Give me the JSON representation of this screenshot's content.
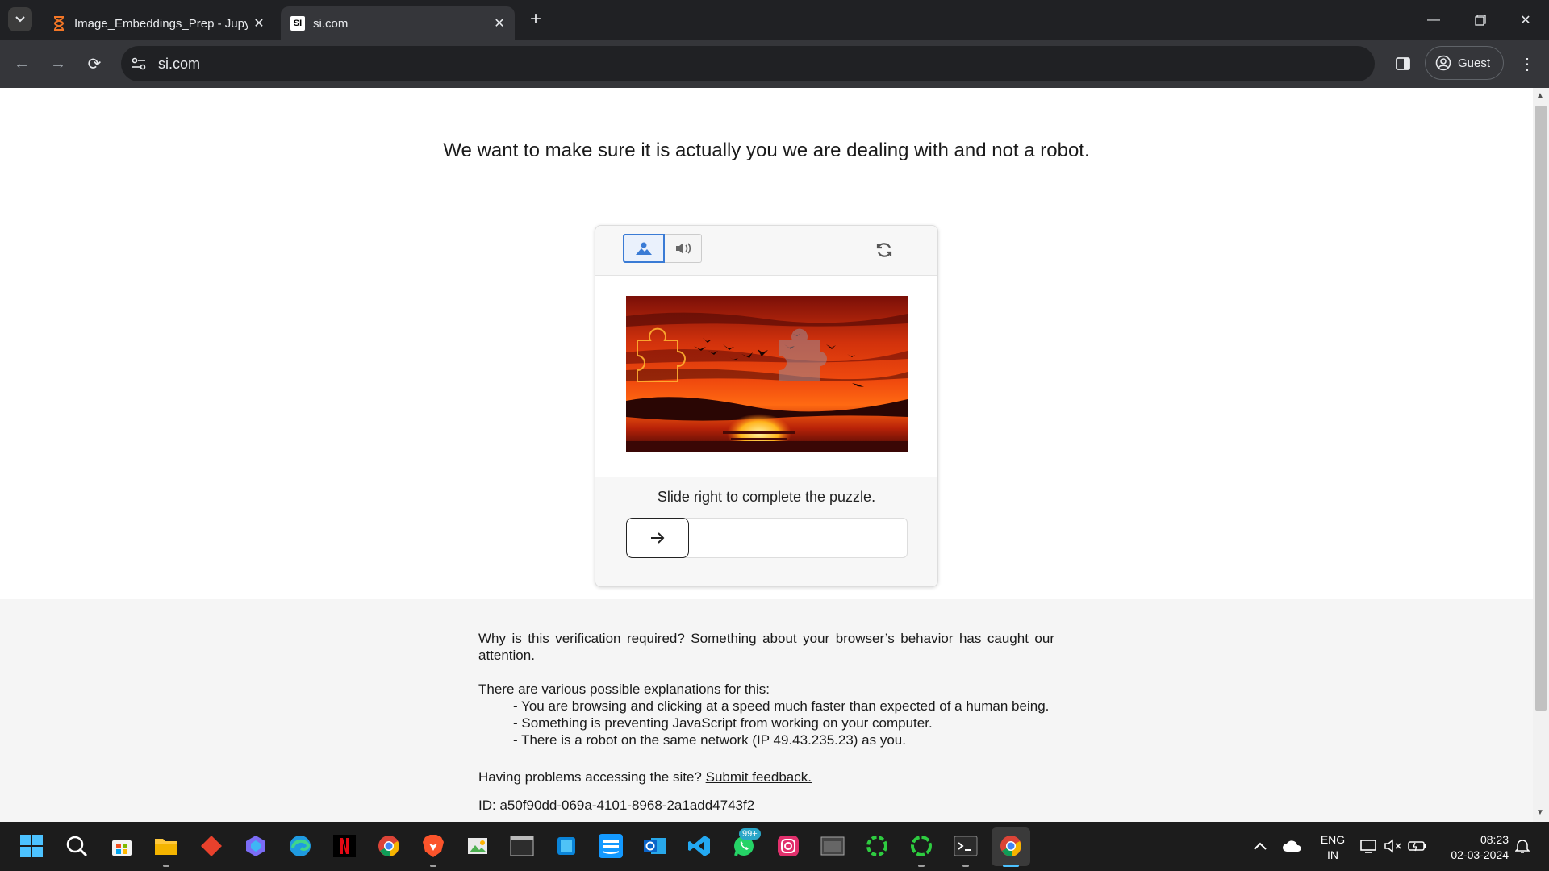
{
  "browser": {
    "tabs": [
      {
        "title": "Image_Embeddings_Prep - Jupyter",
        "icon": "hourglass-icon"
      },
      {
        "title": "si.com",
        "icon": "si-logo-icon"
      }
    ],
    "favicon_si": "SI",
    "address": "si.com",
    "profile_label": "Guest"
  },
  "page": {
    "headline": "We want to make sure it is actually you we are dealing with and not a robot.",
    "captcha": {
      "instruction": "Slide right to complete the puzzle.",
      "slider_value": 0
    },
    "info": {
      "why": "Why is this verification required? Something about your browser’s behavior has caught our attention.",
      "intro": "There are various possible explanations for this:",
      "reasons": [
        "- You are browsing and clicking at a speed much faster than expected of a human being.",
        "- Something is preventing JavaScript from working on your computer.",
        "- There is a robot on the same network (IP 49.43.235.23) as you."
      ],
      "problems_prefix": "Having problems accessing the site?",
      "feedback_link": "Submit feedback.",
      "id_line": "ID: a50f90dd-069a-4101-8968-2a1add4743f2"
    }
  },
  "taskbar": {
    "whatsapp_badge": "99+",
    "lang_top": "ENG",
    "lang_bottom": "IN",
    "time": "08:23",
    "date": "02-03-2024"
  }
}
